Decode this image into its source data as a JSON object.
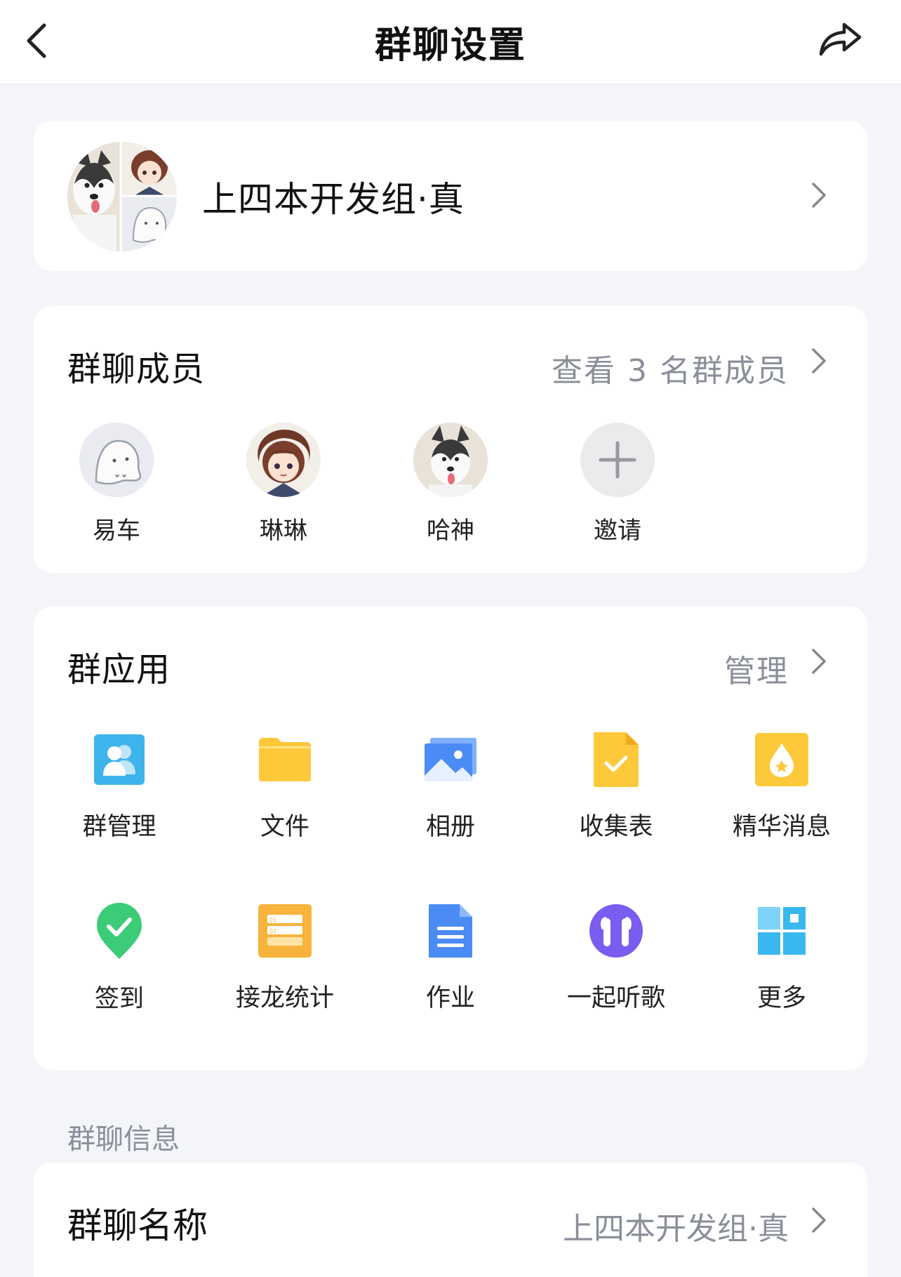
{
  "navbar": {
    "title": "群聊设置",
    "back_icon": "chevron-left-icon",
    "share_icon": "share-arrow-icon"
  },
  "group": {
    "name": "上四本开发组·真"
  },
  "members": {
    "title": "群聊成员",
    "link": "查看 3 名群成员",
    "items": [
      {
        "name": "易车",
        "avatar": "ghost-avatar"
      },
      {
        "name": "琳琳",
        "avatar": "anime-girl-avatar"
      },
      {
        "name": "哈神",
        "avatar": "husky-dog-avatar"
      },
      {
        "name": "邀请",
        "avatar": "plus-icon"
      }
    ]
  },
  "apps": {
    "title": "群应用",
    "link": "管理",
    "items": [
      {
        "label": "群管理",
        "icon": "group-manage-icon",
        "color": "#3fb4ec"
      },
      {
        "label": "文件",
        "icon": "folder-icon",
        "color": "#fdc93a"
      },
      {
        "label": "相册",
        "icon": "album-icon",
        "color": "#4a8bf5"
      },
      {
        "label": "收集表",
        "icon": "collect-form-icon",
        "color": "#fdc93a"
      },
      {
        "label": "精华消息",
        "icon": "essence-message-icon",
        "color": "#fdc93a"
      },
      {
        "label": "签到",
        "icon": "check-in-icon",
        "color": "#3ccc78"
      },
      {
        "label": "接龙统计",
        "icon": "chain-stats-icon",
        "color": "#f7b33b"
      },
      {
        "label": "作业",
        "icon": "homework-icon",
        "color": "#4a8bf5"
      },
      {
        "label": "一起听歌",
        "icon": "listen-together-icon",
        "color": "#7b5cf0"
      },
      {
        "label": "更多",
        "icon": "more-grid-icon",
        "color": "#39b8f0"
      }
    ]
  },
  "info": {
    "section_label": "群聊信息",
    "name_title": "群聊名称",
    "name_value": "上四本开发组·真"
  },
  "colors": {
    "background": "#f4f5f9",
    "card": "#ffffff",
    "secondary_text": "#8a8f99"
  }
}
